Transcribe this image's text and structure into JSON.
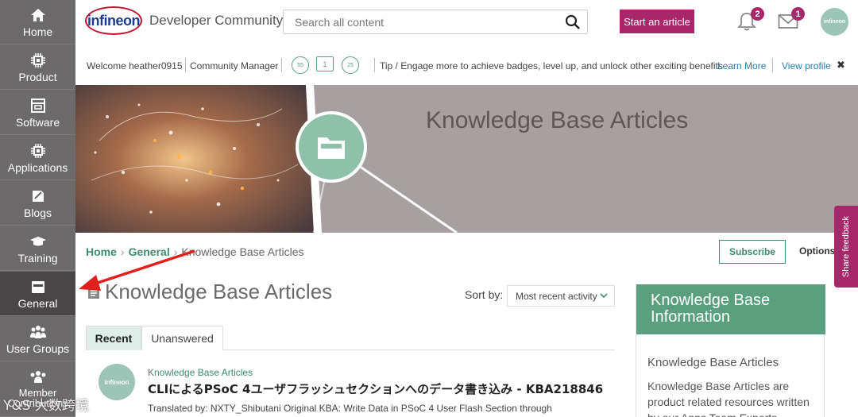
{
  "sidebar": {
    "items": [
      {
        "label": "Home",
        "icon": "home-icon"
      },
      {
        "label": "Product",
        "icon": "chip-icon"
      },
      {
        "label": "Software",
        "icon": "software-icon"
      },
      {
        "label": "Applications",
        "icon": "chip-icon"
      },
      {
        "label": "Blogs",
        "icon": "blog-icon"
      },
      {
        "label": "Training",
        "icon": "graduation-cap-icon"
      },
      {
        "label": "General",
        "icon": "folder-icon",
        "active": true
      },
      {
        "label": "User Groups",
        "icon": "users-icon"
      },
      {
        "label": "Member Contributions",
        "icon": "members-icon"
      }
    ],
    "watermark": "Y&S 大数跨境"
  },
  "header": {
    "logo_text": "infineon",
    "brand": "Developer Community",
    "search_placeholder": "Search all content",
    "start_article": "Start an article",
    "notif_count": "2",
    "mail_count": "1",
    "avatar_text": "infineon"
  },
  "infobar": {
    "welcome": "Welcome heather0915",
    "role": "Community Manager",
    "badge1": "55",
    "badge2": "1",
    "badge3": "25",
    "tip": "Tip / Engage more to achieve badges, level up, and unlock other exciting benefits",
    "learn_more": "Learn More",
    "view_profile": "View profile",
    "close": "✖"
  },
  "banner": {
    "title": "Knowledge Base Articles"
  },
  "breadcrumb": {
    "home": "Home",
    "general": "General",
    "current": "Knowledge Base Articles"
  },
  "actions": {
    "subscribe": "Subscribe",
    "options": "Options",
    "share_feedback": "Share feedback"
  },
  "main": {
    "title": "Knowledge Base Articles",
    "sort_label": "Sort by:",
    "sort_value": "Most recent activity",
    "tabs": [
      "Recent",
      "Unanswered"
    ]
  },
  "article": {
    "avatar_text": "infineon",
    "category": "Knowledge Base Articles",
    "title": "CLIによるPSoC 4ユーザフラッシュセクションへのデータ書き込み - KBA218846",
    "excerpt": "Translated by: NXTY_Shibutani Original KBA: Write Data in PSoC 4 User Flash Section through"
  },
  "info_panel": {
    "heading": "Knowledge Base Information",
    "subheading": "Knowledge Base Articles",
    "text": "Knowledge Base Articles are product related resources written by our Apps Team Experts"
  },
  "colors": {
    "sidebar": "#6d6a6b",
    "sidebar_active": "#4a4647",
    "accent_magenta": "#a8276b",
    "accent_green": "#5aa07f",
    "banner": "#a7a0a1"
  }
}
